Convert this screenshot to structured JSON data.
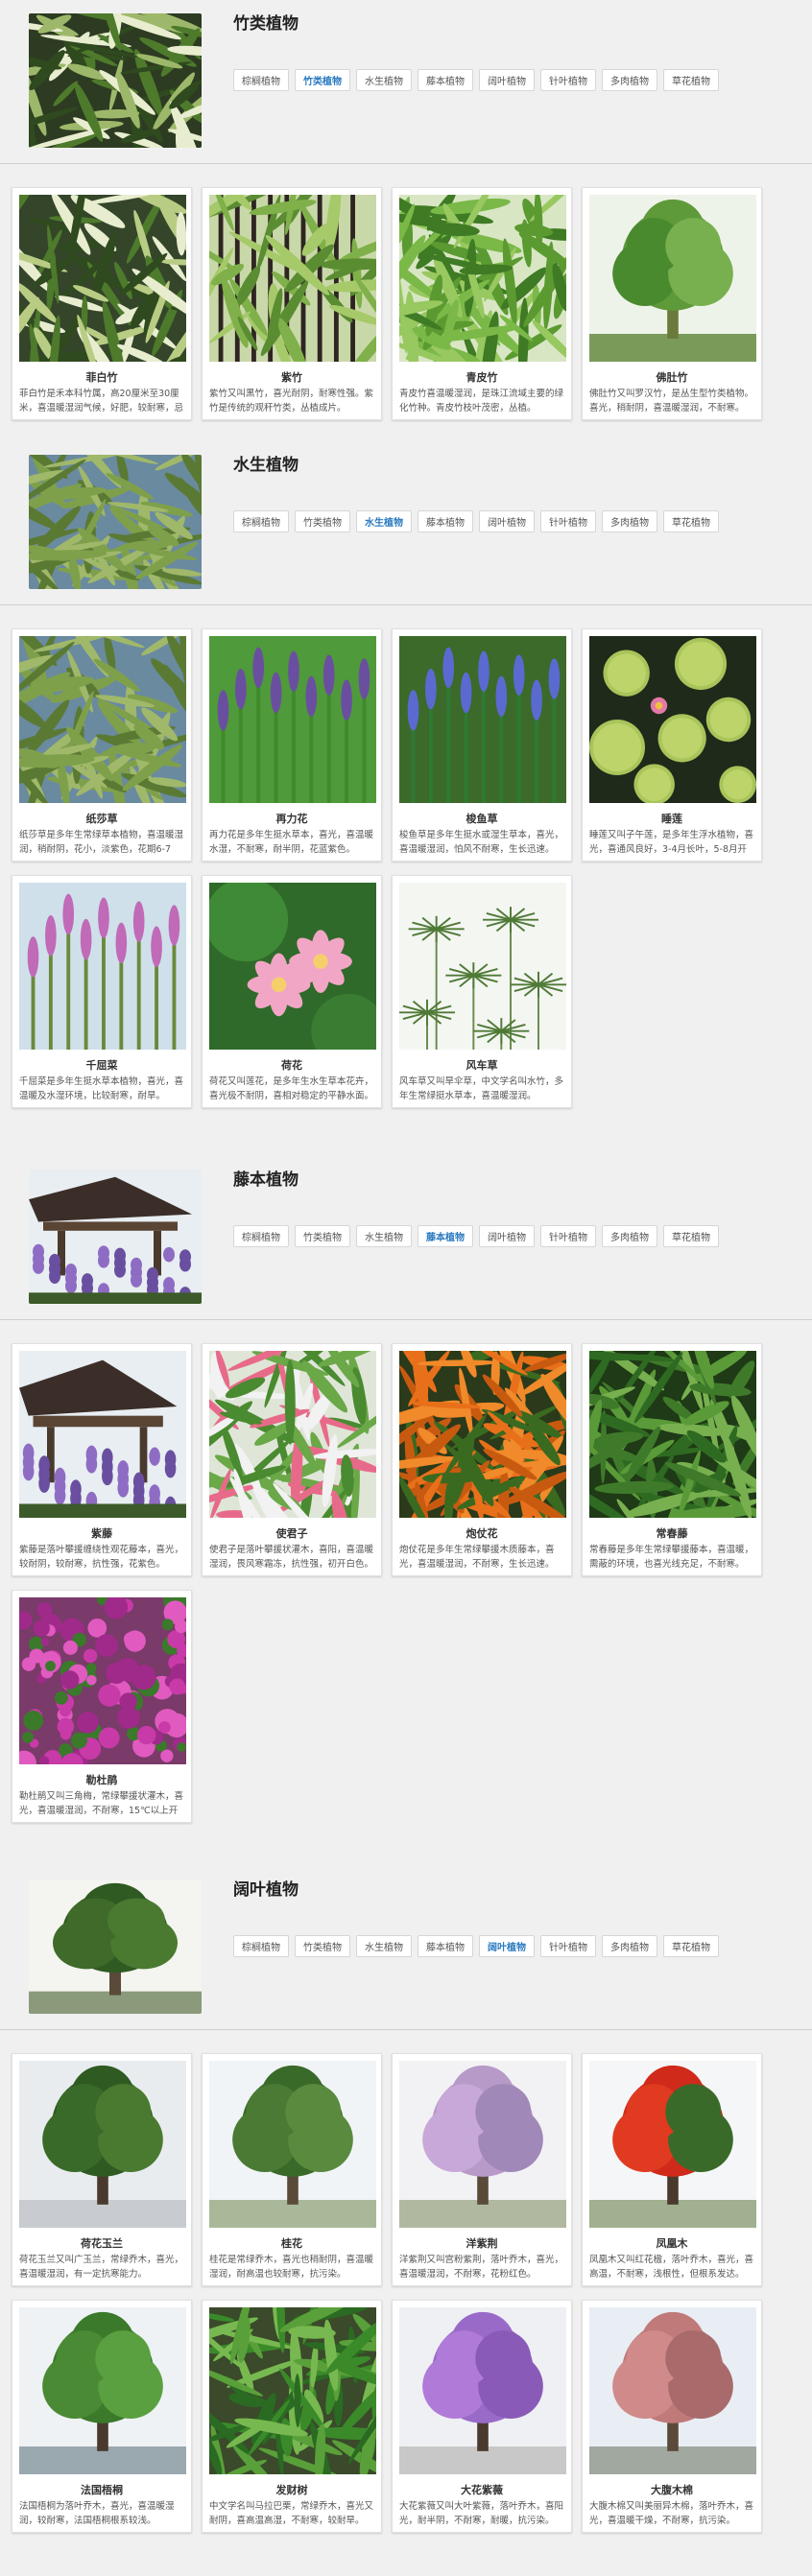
{
  "tag_labels": [
    "棕榈植物",
    "竹类植物",
    "水生植物",
    "藤本植物",
    "阔叶植物",
    "针叶植物",
    "多肉植物",
    "草花植物"
  ],
  "sections": [
    {
      "title": "竹类植物",
      "active_tag": 1,
      "thumb": "bamboo",
      "plants": [
        {
          "name": "菲白竹",
          "desc": "菲白竹是禾本科竹属，高20厘米至30厘米，喜温暖湿润气候，好肥，较耐寒，忌烈日。",
          "img": "bamboo-leaves"
        },
        {
          "name": "紫竹",
          "desc": "紫竹又叫黑竹，喜光耐阴，耐寒性强。紫竹是传统的观秆竹类，丛植成片。",
          "img": "purple-bamboo"
        },
        {
          "name": "青皮竹",
          "desc": "青皮竹喜温暖湿润，是珠江流域主要的绿化竹种。青皮竹枝叶茂密，丛植。",
          "img": "green-bamboo"
        },
        {
          "name": "佛肚竹",
          "desc": "佛肚竹又叫罗汉竹，是丛生型竹类植物。喜光，稍耐阴，喜温暖湿润，不耐寒。",
          "img": "buddha-bamboo"
        }
      ]
    },
    {
      "title": "水生植物",
      "active_tag": 2,
      "thumb": "papyrus",
      "plants": [
        {
          "name": "纸莎草",
          "desc": "纸莎草是多年生常绿草本植物，喜温暖湿润，稍耐阴，花小，淡紫色，花期6-7月。",
          "img": "papyrus"
        },
        {
          "name": "再力花",
          "desc": "再力花是多年生挺水草本，喜光，喜温暖水湿，不耐寒，耐半阴，花蓝紫色。",
          "img": "thalia"
        },
        {
          "name": "梭鱼草",
          "desc": "梭鱼草是多年生挺水或湿生草本，喜光，喜温暖湿润，怕风不耐寒，生长迅速。",
          "img": "pickerel"
        },
        {
          "name": "睡莲",
          "desc": "睡莲又叫子午莲，是多年生浮水植物，喜光，喜通风良好，3-4月长叶，5-8月开花。",
          "img": "waterlily"
        },
        {
          "name": "千屈菜",
          "desc": "千屈菜是多年生挺水草本植物，喜光，喜温暖及水湿环境，比较耐寒，耐旱。",
          "img": "loosestrife"
        },
        {
          "name": "荷花",
          "desc": "荷花又叫莲花，是多年生水生草本花卉，喜光极不耐阴，喜相对稳定的平静水面。",
          "img": "lotus"
        },
        {
          "name": "风车草",
          "desc": "风车草又叫旱伞草，中文学名叫水竹，多年生常绿挺水草本，喜温暖湿润。",
          "img": "umbrella"
        }
      ]
    },
    {
      "title": "藤本植物",
      "active_tag": 3,
      "thumb": "wisteria",
      "plants": [
        {
          "name": "紫藤",
          "desc": "紫藤是落叶攀援缠绕性观花藤本，喜光，较耐阴，较耐寒，抗性强，花紫色。",
          "img": "wisteria"
        },
        {
          "name": "使君子",
          "desc": "使君子是落叶攀援状灌木，喜阳，喜温暖湿润，畏风寒霜冻，抗性强，初开白色。",
          "img": "rangoon"
        },
        {
          "name": "炮仗花",
          "desc": "炮仗花是多年生常绿攀援木质藤本，喜光，喜温暖湿润，不耐寒，生长迅速。",
          "img": "firecracker"
        },
        {
          "name": "常春藤",
          "desc": "常春藤是多年生常绿攀援藤本，喜温暖，需蔽的环境，也喜光线充足，不耐寒。",
          "img": "ivy"
        },
        {
          "name": "勒杜鹃",
          "desc": "勒杜鹃又叫三角梅，常绿攀援状灌木，喜光，喜温暖湿润，不耐寒，15℃以上开花。",
          "img": "bougainvillea"
        }
      ]
    },
    {
      "title": "阔叶植物",
      "active_tag": 4,
      "thumb": "broadleaf",
      "plants": [
        {
          "name": "荷花玉兰",
          "desc": "荷花玉兰又叫广玉兰，常绿乔木，喜光，喜温暖湿润，有一定抗寒能力。",
          "img": "magnolia"
        },
        {
          "name": "桂花",
          "desc": "桂花是常绿乔木，喜光也稍耐阴，喜温暖湿润，耐高温也较耐寒，抗污染。",
          "img": "osmanthus"
        },
        {
          "name": "洋紫荆",
          "desc": "洋紫荆又叫宫粉紫荆，落叶乔木，喜光，喜温暖湿润，不耐寒，花粉红色。",
          "img": "bauhinia"
        },
        {
          "name": "凤凰木",
          "desc": "凤凰木又叫红花楹，落叶乔木，喜光，喜高温，不耐寒，浅根性，但根系发达。",
          "img": "flametree"
        },
        {
          "name": "法国梧桐",
          "desc": "法国梧桐为落叶乔木，喜光，喜温暖湿润，较耐寒，法国梧桐根系较浅。",
          "img": "plane"
        },
        {
          "name": "发财树",
          "desc": "中文学名叫马拉巴栗，常绿乔木，喜光又耐阴，喜高温高湿，不耐寒，较耐旱。",
          "img": "moneytree"
        },
        {
          "name": "大花紫薇",
          "desc": "大花紫薇又叫大叶紫薇，落叶乔木，喜阳光，耐半阴，不耐寒，耐暖，抗污染。",
          "img": "crapemyrtle"
        },
        {
          "name": "大腹木棉",
          "desc": "大腹木棉又叫美丽异木棉，落叶乔木，喜光，喜温暖干燥，不耐寒，抗污染。",
          "img": "silkfloss"
        }
      ]
    }
  ],
  "colors": {
    "active_tag": "#2a7ac0",
    "background": "#f0f0f0",
    "card": "#ffffff"
  }
}
